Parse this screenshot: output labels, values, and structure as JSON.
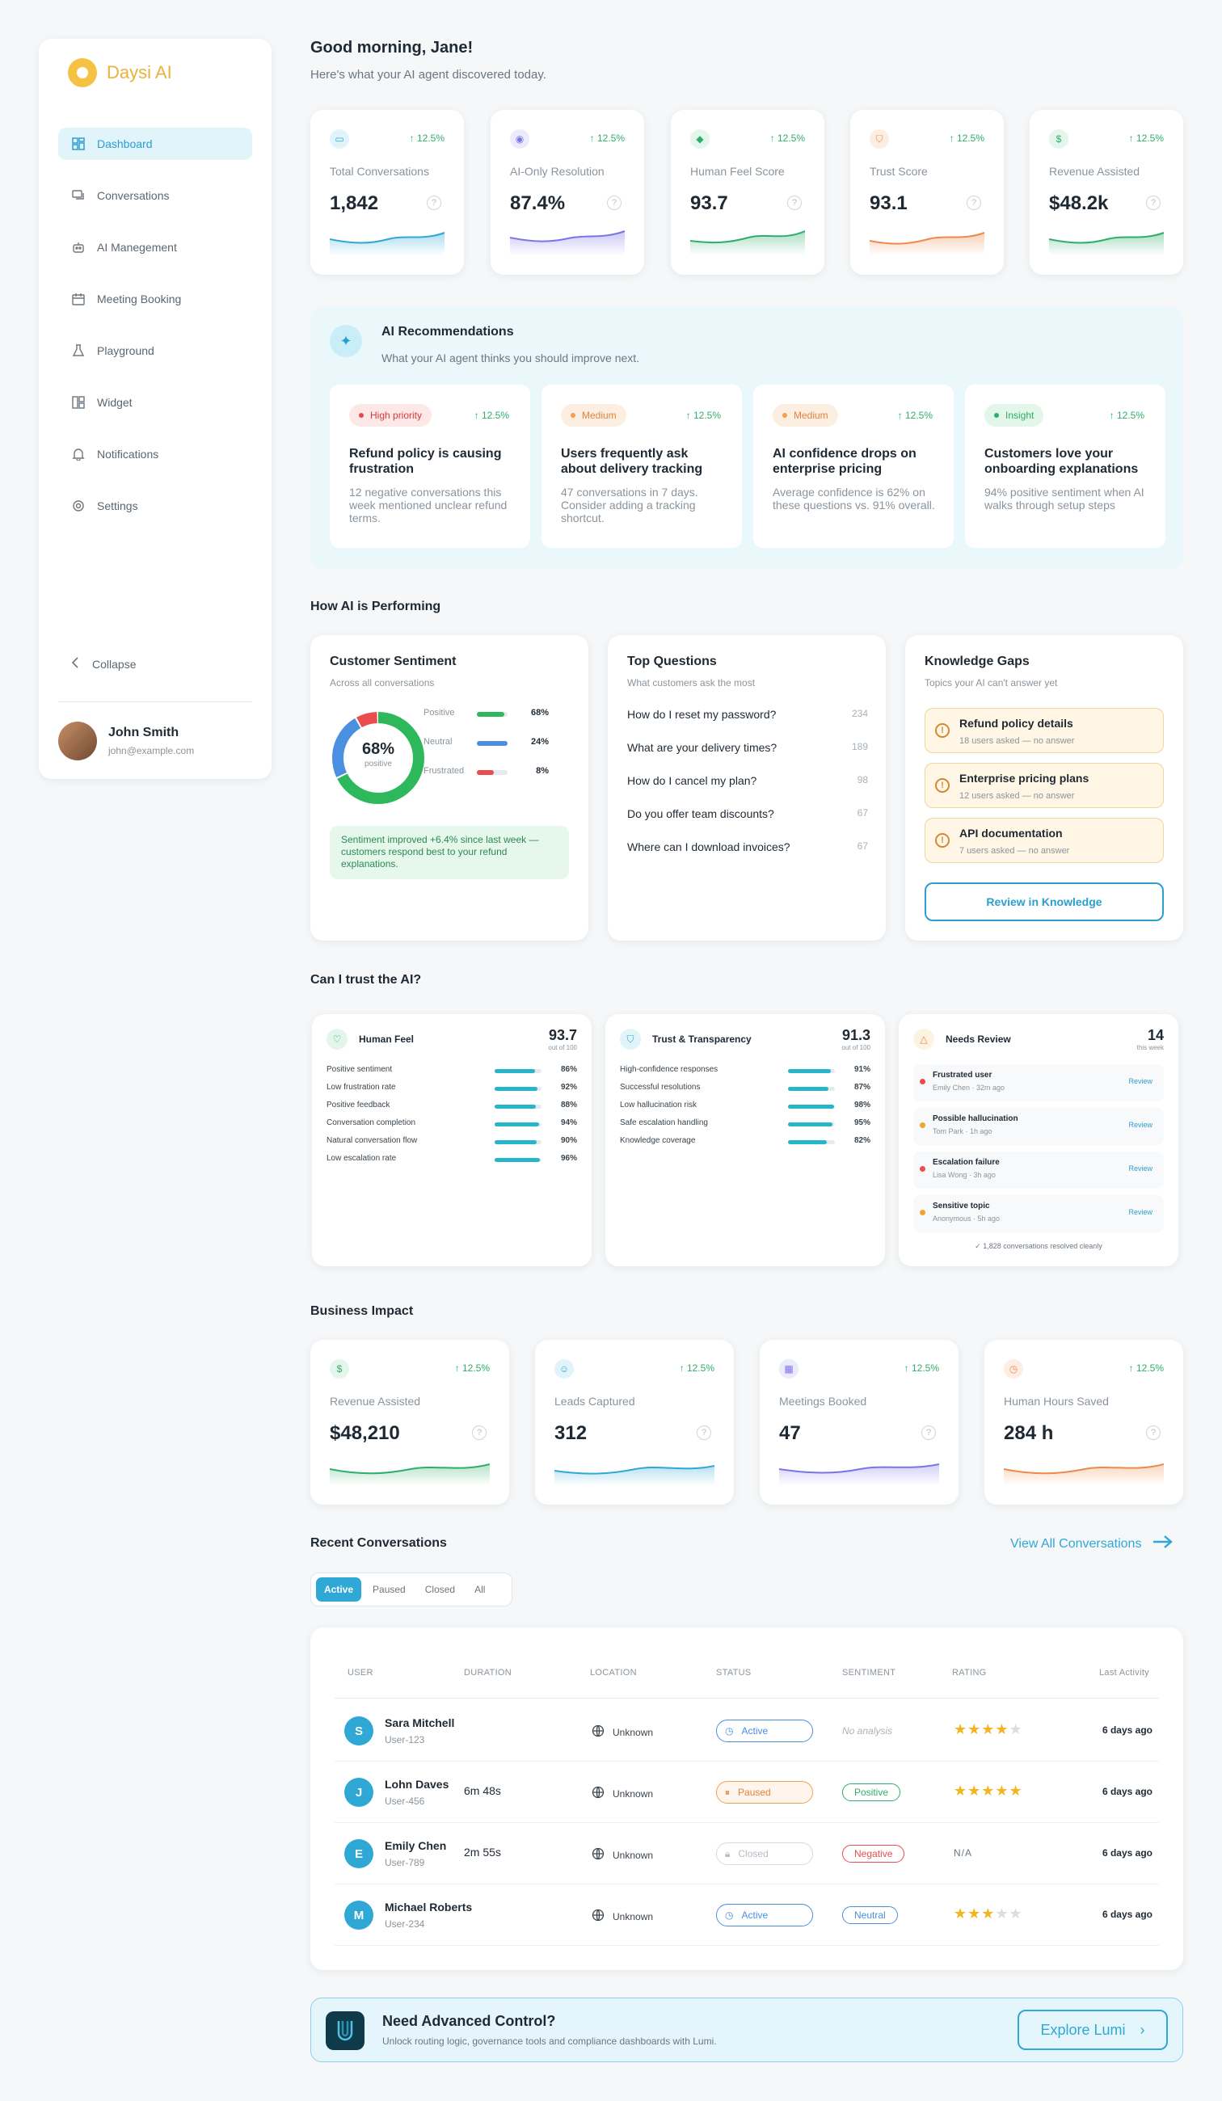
{
  "app": {
    "name": "Daysi AI"
  },
  "sidebar": {
    "items": [
      {
        "label": "Dashboard",
        "icon": "dashboard-icon"
      },
      {
        "label": "Conversations",
        "icon": "chat-icon"
      },
      {
        "label": "AI Manegement",
        "icon": "robot-icon"
      },
      {
        "label": "Meeting Booking",
        "icon": "calendar-icon"
      },
      {
        "label": "Playground",
        "icon": "flask-icon"
      },
      {
        "label": "Widget",
        "icon": "widget-icon"
      },
      {
        "label": "Notifications",
        "icon": "bell-icon"
      },
      {
        "label": "Settings",
        "icon": "gear-icon"
      }
    ],
    "collapse_label": "Collapse",
    "user": {
      "name": "John Smith",
      "email": "john@example.com"
    }
  },
  "header": {
    "greeting": "Good morning, Jane!",
    "subtitle": "Here's what your AI agent discovered today."
  },
  "stats": [
    {
      "label": "Total Conversations",
      "value": "1,842",
      "trend": "12.5%",
      "icon": "chat-icon",
      "color": "#2fa8d6"
    },
    {
      "label": "AI-Only Resolution",
      "value": "87.4%",
      "trend": "12.5%",
      "icon": "robot-icon",
      "color": "#7b74e8"
    },
    {
      "label": "Human Feel Score",
      "value": "93.7",
      "trend": "12.5%",
      "icon": "tag-icon",
      "color": "#2eae6a"
    },
    {
      "label": "Trust Score",
      "value": "93.1",
      "trend": "12.5%",
      "icon": "shield-icon",
      "color": "#ee8a4a"
    },
    {
      "label": "Revenue Assisted",
      "value": "$48.2k",
      "trend": "12.5%",
      "icon": "dollar-icon",
      "color": "#2eae6a"
    }
  ],
  "recommendations": {
    "title": "AI Recommendations",
    "subtitle": "What your AI agent thinks you should improve next.",
    "cards": [
      {
        "tag": "High priority",
        "trend": "12.5%",
        "title": "Refund policy is causing frustration",
        "body": "12 negative conversations this week mentioned unclear refund terms."
      },
      {
        "tag": "Medium",
        "trend": "12.5%",
        "title": "Users frequently ask about delivery tracking",
        "body": "47 conversations in 7 days. Consider adding a tracking shortcut."
      },
      {
        "tag": "Medium",
        "trend": "12.5%",
        "title": "AI confidence drops on enterprise pricing",
        "body": "Average confidence is 62% on these questions vs. 91% overall."
      },
      {
        "tag": "Insight",
        "trend": "12.5%",
        "title": "Customers love your onboarding explanations",
        "body": "94% positive sentiment when AI walks through setup steps"
      }
    ]
  },
  "performance": {
    "title": "How AI is Performing",
    "sentiment": {
      "title": "Customer Sentiment",
      "subtitle": "Across all conversations",
      "center_value": "68%",
      "center_label": "positive",
      "legend": [
        {
          "label": "Positive",
          "value": "68%",
          "pct": 68,
          "color": "#2eb85c"
        },
        {
          "label": "Neutral",
          "value": "24%",
          "pct": 24,
          "color": "#4a8fe0"
        },
        {
          "label": "Frustrated",
          "value": "8%",
          "pct": 8,
          "color": "#ea4d4d"
        }
      ],
      "callout": "Sentiment improved +6.4% since last week — customers respond best to your refund explanations."
    },
    "top_questions": {
      "title": "Top Questions",
      "subtitle": "What customers ask the most",
      "items": [
        {
          "q": "How do I reset my password?",
          "count": "234"
        },
        {
          "q": "What are your delivery times?",
          "count": "189"
        },
        {
          "q": "How do I cancel my plan?",
          "count": "98"
        },
        {
          "q": "Do you offer team discounts?",
          "count": "67"
        },
        {
          "q": "Where can I download invoices?",
          "count": "67"
        }
      ]
    },
    "knowledge_gaps": {
      "title": "Knowledge Gaps",
      "subtitle": "Topics your AI can't answer yet",
      "items": [
        {
          "title": "Refund policy details",
          "sub": "18 users asked — no answer"
        },
        {
          "title": "Enterprise pricing plans",
          "sub": "12 users asked — no answer"
        },
        {
          "title": "API documentation",
          "sub": "7 users asked — no answer"
        }
      ],
      "button": "Review in Knowledge"
    }
  },
  "trust": {
    "title": "Can I trust the AI?",
    "human_feel": {
      "title": "Human Feel",
      "score": "93.7",
      "out_of": "out of 100",
      "metrics": [
        {
          "label": "Positive sentiment",
          "value": "86%",
          "pct": 86
        },
        {
          "label": "Low frustration rate",
          "value": "92%",
          "pct": 92
        },
        {
          "label": "Positive feedback",
          "value": "88%",
          "pct": 88
        },
        {
          "label": "Conversation completion",
          "value": "94%",
          "pct": 94
        },
        {
          "label": "Natural conversation flow",
          "value": "90%",
          "pct": 90
        },
        {
          "label": "Low escalation rate",
          "value": "96%",
          "pct": 96
        }
      ]
    },
    "transparency": {
      "title": "Trust & Transparency",
      "score": "91.3",
      "out_of": "out of 100",
      "metrics": [
        {
          "label": "High-confidence responses",
          "value": "91%",
          "pct": 91
        },
        {
          "label": "Successful resolutions",
          "value": "87%",
          "pct": 87
        },
        {
          "label": "Low hallucination risk",
          "value": "98%",
          "pct": 98
        },
        {
          "label": "Safe escalation handling",
          "value": "95%",
          "pct": 95
        },
        {
          "label": "Knowledge coverage",
          "value": "82%",
          "pct": 82
        }
      ]
    },
    "needs_review": {
      "title": "Needs Review",
      "count": "14",
      "count_label": "this week",
      "items": [
        {
          "title": "Frustrated user",
          "sub": "Emily Chen · 32m ago",
          "action": "Review",
          "color": "#ea4d4d"
        },
        {
          "title": "Possible hallucination",
          "sub": "Tom Park · 1h ago",
          "action": "Review",
          "color": "#f0a52d"
        },
        {
          "title": "Escalation failure",
          "sub": "Lisa Wong · 3h ago",
          "action": "Review",
          "color": "#ea4d4d"
        },
        {
          "title": "Sensitive topic",
          "sub": "Anonymous · 5h ago",
          "action": "Review",
          "color": "#f0a52d"
        }
      ],
      "footer": "1,828 conversations resolved cleanly"
    }
  },
  "business": {
    "title": "Business Impact",
    "cards": [
      {
        "label": "Revenue Assisted",
        "value": "$48,210",
        "trend": "12.5%",
        "icon": "dollar-icon",
        "color": "#2eae6a"
      },
      {
        "label": "Leads Captured",
        "value": "312",
        "trend": "12.5%",
        "icon": "users-icon",
        "color": "#2fa8d6"
      },
      {
        "label": "Meetings Booked",
        "value": "47",
        "trend": "12.5%",
        "icon": "calendar-icon",
        "color": "#7b74e8"
      },
      {
        "label": "Human Hours Saved",
        "value": "284 h",
        "trend": "12.5%",
        "icon": "clock-icon",
        "color": "#ee8a4a"
      }
    ]
  },
  "recent": {
    "title": "Recent Conversations",
    "view_all": "View All Conversations",
    "tabs": [
      "Active",
      "Paused",
      "Closed",
      "All"
    ],
    "columns": [
      "USER",
      "DURATION",
      "LOCATION",
      "STATUS",
      "SENTIMENT",
      "RATING",
      "Last Activity"
    ],
    "rows": [
      {
        "initial": "S",
        "name": "Sara Mitchell",
        "id": "User-123",
        "duration": "",
        "location": "Unknown",
        "status": "Active",
        "sentiment": "No analysis",
        "rating": 4,
        "last": "6 days ago"
      },
      {
        "initial": "J",
        "name": "Lohn Daves",
        "id": "User-456",
        "duration": "6m 48s",
        "location": "Unknown",
        "status": "Paused",
        "sentiment": "Positive",
        "rating": 5,
        "last": "6 days ago"
      },
      {
        "initial": "E",
        "name": "Emily Chen",
        "id": "User-789",
        "duration": "2m 55s",
        "location": "Unknown",
        "status": "Closed",
        "sentiment": "Negative",
        "rating": "N/A",
        "last": "6 days ago"
      },
      {
        "initial": "M",
        "name": "Michael Roberts",
        "id": "User-234",
        "duration": "",
        "location": "Unknown",
        "status": "Active",
        "sentiment": "Neutral",
        "rating": 3,
        "last": "6 days ago"
      }
    ]
  },
  "banner": {
    "title": "Need Advanced Control?",
    "subtitle": "Unlock routing logic, governance tools and compliance dashboards with Lumi.",
    "button": "Explore Lumi"
  }
}
